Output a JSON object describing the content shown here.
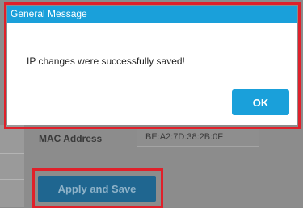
{
  "dialog": {
    "title": "General Message",
    "message": "IP changes were successfully saved!",
    "ok_label": "OK"
  },
  "background": {
    "mac_label": "MAC Address",
    "mac_value": "BE:A2:7D:38:2B:0F",
    "apply_label": "Apply and Save"
  },
  "colors": {
    "header": "#1aa0da",
    "highlight": "#e0202a",
    "overlay": "#8c8c8c"
  }
}
